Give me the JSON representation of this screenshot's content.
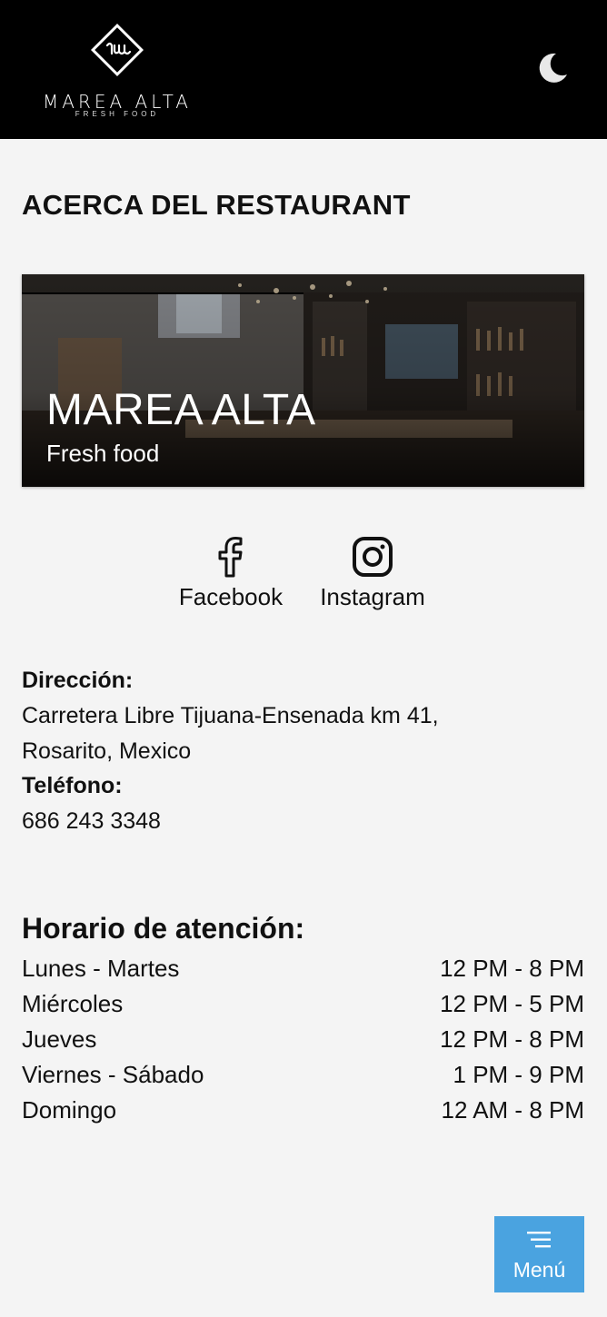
{
  "header": {
    "logo_name": "MAREA ALTA",
    "logo_sub": "FRESH FOOD",
    "theme_icon": "moon-icon"
  },
  "about": {
    "title": "ACERCA DEL RESTAURANT",
    "hero_title": "MAREA ALTA",
    "hero_subtitle": "Fresh food"
  },
  "social": {
    "facebook_label": "Facebook",
    "facebook_icon": "facebook-icon",
    "instagram_label": "Instagram",
    "instagram_icon": "instagram-icon"
  },
  "contact": {
    "address_label": "Dirección:",
    "address_line1": "Carretera Libre Tijuana-Ensenada km 41,",
    "address_line2": "Rosarito, Mexico",
    "phone_label": "Teléfono:",
    "phone": "686 243 3348"
  },
  "hours": {
    "title": "Horario de atención:",
    "rows": [
      {
        "day": "Lunes - Martes",
        "time": "12 PM - 8 PM"
      },
      {
        "day": "Miércoles",
        "time": "12 PM - 5 PM"
      },
      {
        "day": "Jueves",
        "time": "12 PM - 8 PM"
      },
      {
        "day": "Viernes - Sábado",
        "time": "1 PM - 9 PM"
      },
      {
        "day": "Domingo",
        "time": "12 AM - 8 PM"
      }
    ]
  },
  "menu_button": {
    "label": "Menú",
    "icon": "menu-lines-icon",
    "color": "#4aa3e0"
  }
}
